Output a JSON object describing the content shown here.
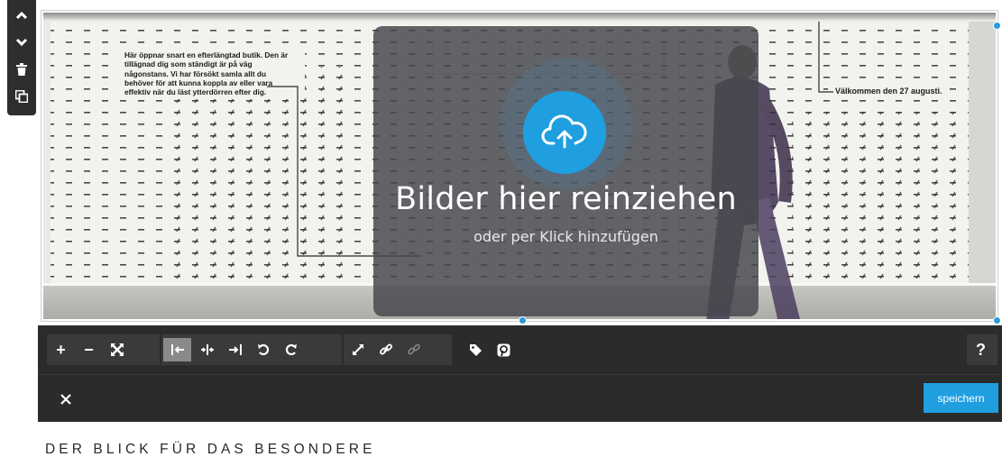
{
  "side_tools": [
    {
      "icon": "chevron-up-icon"
    },
    {
      "icon": "chevron-down-icon"
    },
    {
      "icon": "trash-icon"
    },
    {
      "icon": "copy-icon"
    }
  ],
  "photo": {
    "wall_paragraph": "Här öppnar snart en efterlängtad butik. Den är tillägnad dig som ständigt är på väg någonstans. Vi har försökt samla allt du behöver för att kunna koppla av eller vara effektiv när du läst ytterdörren efter dig.",
    "wall_welcome": "Välkommen den 27 augusti."
  },
  "dropzone": {
    "title": "Bilder hier reinziehen",
    "subtitle": "oder per Klick hinzufügen",
    "icon": "cloud-upload-icon"
  },
  "toolbar": {
    "zoom_in": "+",
    "zoom_out": "−",
    "help": "?"
  },
  "footer": {
    "save_label": "speichern",
    "close_icon": "close-icon"
  },
  "section_heading": "DER BLICK FÜR DAS BESONDERE",
  "colors": {
    "accent": "#1f9ee0",
    "toolbar_bg": "#2b2b2b",
    "overlay": "#46484c"
  }
}
